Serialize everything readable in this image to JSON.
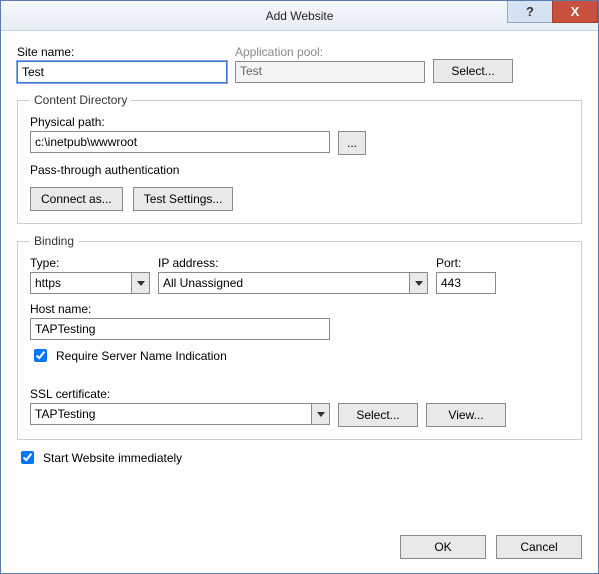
{
  "titlebar": {
    "title": "Add Website",
    "help": "?",
    "close": "X"
  },
  "site": {
    "name_label": "Site name:",
    "name_value": "Test",
    "pool_label": "Application pool:",
    "pool_value": "Test",
    "select_btn": "Select..."
  },
  "content_dir": {
    "legend": "Content Directory",
    "path_label": "Physical path:",
    "path_value": "c:\\inetpub\\wwwroot",
    "browse_btn": "...",
    "passthrough": "Pass-through authentication",
    "connect_as": "Connect as...",
    "test_settings": "Test Settings..."
  },
  "binding": {
    "legend": "Binding",
    "type_label": "Type:",
    "type_value": "https",
    "ip_label": "IP address:",
    "ip_value": "All Unassigned",
    "port_label": "Port:",
    "port_value": "443",
    "host_label": "Host name:",
    "host_value": "TAPTesting",
    "require_sni": "Require Server Name Indication",
    "ssl_label": "SSL certificate:",
    "ssl_value": "TAPTesting",
    "select_btn": "Select...",
    "view_btn": "View..."
  },
  "start_immediately": "Start Website immediately",
  "footer": {
    "ok": "OK",
    "cancel": "Cancel"
  }
}
